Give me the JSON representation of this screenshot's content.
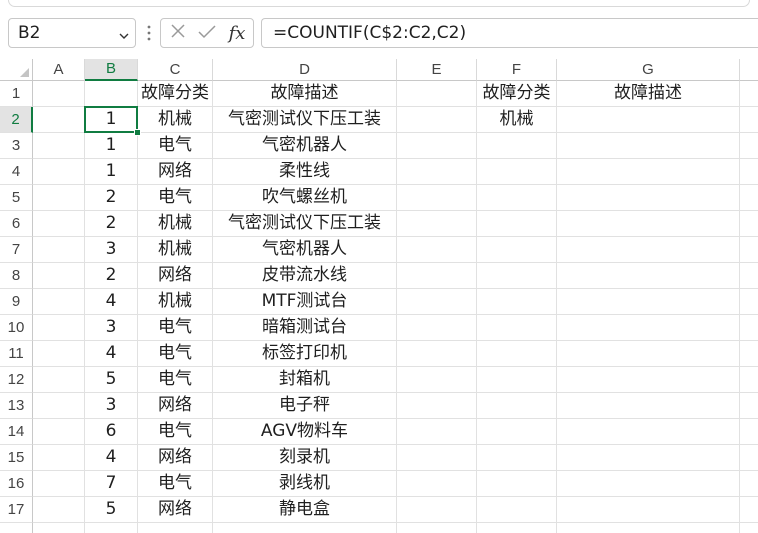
{
  "formula_bar": {
    "name_box": "B2",
    "insert_function_label": "fx",
    "formula": "=COUNTIF(C$2:C2,C2)"
  },
  "icons": {
    "name_box_dropdown": "chevron-down-icon",
    "more_options": "vertical-dots-icon",
    "cancel_edit": "close-icon",
    "confirm_edit": "check-icon",
    "select_all": "select-all-corner-icon"
  },
  "colors": {
    "accent": "#107c41",
    "gridline": "#e1e1e1",
    "header_border": "#c8c8c8",
    "header_text": "#444444",
    "selected_header_bg": "#e3e3e3",
    "cell_text": "#1f1f1f"
  },
  "sheet": {
    "columns": [
      "A",
      "B",
      "C",
      "D",
      "E",
      "F",
      "G"
    ],
    "rows": [
      {
        "label": "1",
        "cells": {
          "C": "故障分类",
          "D": "故障描述",
          "F": "故障分类",
          "G": "故障描述"
        }
      },
      {
        "label": "2",
        "cells": {
          "B": "1",
          "C": "机械",
          "D": "气密测试仪下压工装",
          "F": "机械"
        }
      },
      {
        "label": "3",
        "cells": {
          "B": "1",
          "C": "电气",
          "D": "气密机器人"
        }
      },
      {
        "label": "4",
        "cells": {
          "B": "1",
          "C": "网络",
          "D": "柔性线"
        }
      },
      {
        "label": "5",
        "cells": {
          "B": "2",
          "C": "电气",
          "D": "吹气螺丝机"
        }
      },
      {
        "label": "6",
        "cells": {
          "B": "2",
          "C": "机械",
          "D": "气密测试仪下压工装"
        }
      },
      {
        "label": "7",
        "cells": {
          "B": "3",
          "C": "机械",
          "D": "气密机器人"
        }
      },
      {
        "label": "8",
        "cells": {
          "B": "2",
          "C": "网络",
          "D": "皮带流水线"
        }
      },
      {
        "label": "9",
        "cells": {
          "B": "4",
          "C": "机械",
          "D": "MTF测试台"
        }
      },
      {
        "label": "10",
        "cells": {
          "B": "3",
          "C": "电气",
          "D": "暗箱测试台"
        }
      },
      {
        "label": "11",
        "cells": {
          "B": "4",
          "C": "电气",
          "D": "标签打印机"
        }
      },
      {
        "label": "12",
        "cells": {
          "B": "5",
          "C": "电气",
          "D": "封箱机"
        }
      },
      {
        "label": "13",
        "cells": {
          "B": "3",
          "C": "网络",
          "D": "电子秤"
        }
      },
      {
        "label": "14",
        "cells": {
          "B": "6",
          "C": "电气",
          "D": "AGV物料车"
        }
      },
      {
        "label": "15",
        "cells": {
          "B": "4",
          "C": "网络",
          "D": "刻录机"
        }
      },
      {
        "label": "16",
        "cells": {
          "B": "7",
          "C": "电气",
          "D": "剥线机"
        }
      },
      {
        "label": "17",
        "cells": {
          "B": "5",
          "C": "网络",
          "D": "静电盒"
        }
      }
    ]
  }
}
